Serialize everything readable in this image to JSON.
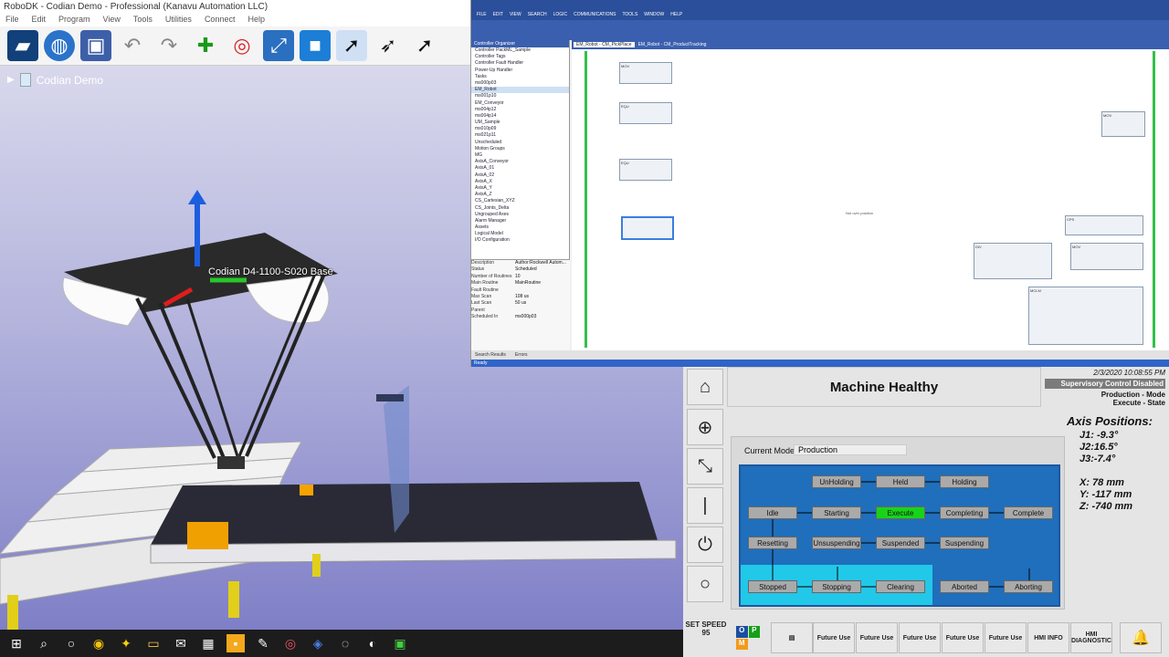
{
  "robodk": {
    "title": "RoboDK - Codian Demo - Professional (Kanavu Automation LLC)",
    "menu": [
      "File",
      "Edit",
      "Program",
      "View",
      "Tools",
      "Utilities",
      "Connect",
      "Help"
    ],
    "toolbar_icons": [
      "station-icon",
      "globe-icon",
      "save-icon",
      "undo-icon",
      "redo-icon",
      "add-frame-icon",
      "add-target-icon",
      "fit-icon",
      "cube-icon",
      "select-icon",
      "move-ref-icon",
      "move-tcp-icon"
    ],
    "tree_root": "Codian Demo",
    "robot_label": "Codian D4-1100-S020 Base"
  },
  "studio": {
    "menu": [
      "FILE",
      "EDIT",
      "VIEW",
      "SEARCH",
      "LOGIC",
      "COMMUNICATIONS",
      "TOOLS",
      "WINDOW",
      "HELP"
    ],
    "organizer_title": "Controller Organizer",
    "organizer_items": [
      "Controller PackML_Sample",
      "Controller Tags",
      "Controller Fault Handler",
      "Power-Up Handler",
      "Tasks",
      "ms000p03",
      "EM_Robot",
      "ms001p10",
      "EM_Conveyor",
      "ms004p12",
      "ms004p14",
      "UM_Sample",
      "ms010p09",
      "ms021p11",
      "Unscheduled",
      "Motion Groups",
      "MG",
      "AxisA_Conveyor",
      "AxisA_01",
      "AxisA_02",
      "AxisA_X",
      "AxisA_Y",
      "AxisA_Z",
      "CS_Cartesian_XYZ",
      "CS_Joints_Delta",
      "Ungrouped Axes",
      "Alarm Manager",
      "Assets",
      "Logical Model",
      "I/O Configuration"
    ],
    "properties": [
      [
        "Description",
        "Author:Rockwell Autom..."
      ],
      [
        "Status",
        "Scheduled"
      ],
      [
        "Number of Routines",
        "10"
      ],
      [
        "Main Routine",
        "MainRoutine"
      ],
      [
        "Fault Routine",
        ""
      ],
      [
        "Max Scan",
        "108 us"
      ],
      [
        "Last Scan",
        "50 us"
      ],
      [
        "Parent",
        ""
      ],
      [
        "Scheduled In",
        "ms000p03"
      ]
    ],
    "tabs": [
      "EM_Robot - CM_PickPlace",
      "EM_Robot - CM_ProductTracking"
    ],
    "bottom_tabs": [
      "Search Results",
      "Errors"
    ],
    "status": "Ready",
    "ladder_labels": [
      "MOV",
      "EQU",
      "MOV",
      "EQU",
      "CPS",
      "DIV",
      "MOV",
      "MCLM",
      "Not over position"
    ]
  },
  "hmi": {
    "banner": "Machine Healthy",
    "datetime": "2/3/2020 10:08:55 PM",
    "supervisory": "Supervisory Control Disabled",
    "mode_line": "Production - Mode",
    "state_line": "Execute - State",
    "current_mode_label": "Current Mode:",
    "current_mode_value": "Production",
    "axis_title": "Axis Positions:",
    "axis": [
      "J1: -9.3°",
      "J2:16.5°",
      "J3:-7.4°",
      "",
      "X: 78 mm",
      "Y: -117 mm",
      "Z: -740 mm"
    ],
    "states": {
      "unholding": "UnHolding",
      "held": "Held",
      "holding": "Holding",
      "idle": "Idle",
      "starting": "Starting",
      "execute": "Execute",
      "completing": "Completing",
      "complete": "Complete",
      "resetting": "Resetting",
      "unsuspending": "Unsuspending",
      "suspended": "Suspended",
      "suspending": "Suspending",
      "stopped": "Stopped",
      "stopping": "Stopping",
      "clearing": "Clearing",
      "aborted": "Aborted",
      "aborting": "Aborting"
    },
    "active_state": "Execute",
    "set_speed_label": "SET SPEED",
    "set_speed_value": "95",
    "ompm": [
      "O",
      "P",
      "M"
    ],
    "function_buttons": [
      "Future Use",
      "Future Use",
      "Future Use",
      "Future Use",
      "Future Use",
      "HMI INFO",
      "HMI DIAGNOSTIC"
    ],
    "left_buttons": [
      "home-icon",
      "plus-icon",
      "collapse-icon",
      "start-icon",
      "power-icon",
      "stop-icon"
    ]
  },
  "colors": {
    "active_state": "#18d418",
    "state_blue": "#1f6fbd",
    "state_cyan": "#22c8e8",
    "studio_blue": "#2b4f9a"
  }
}
